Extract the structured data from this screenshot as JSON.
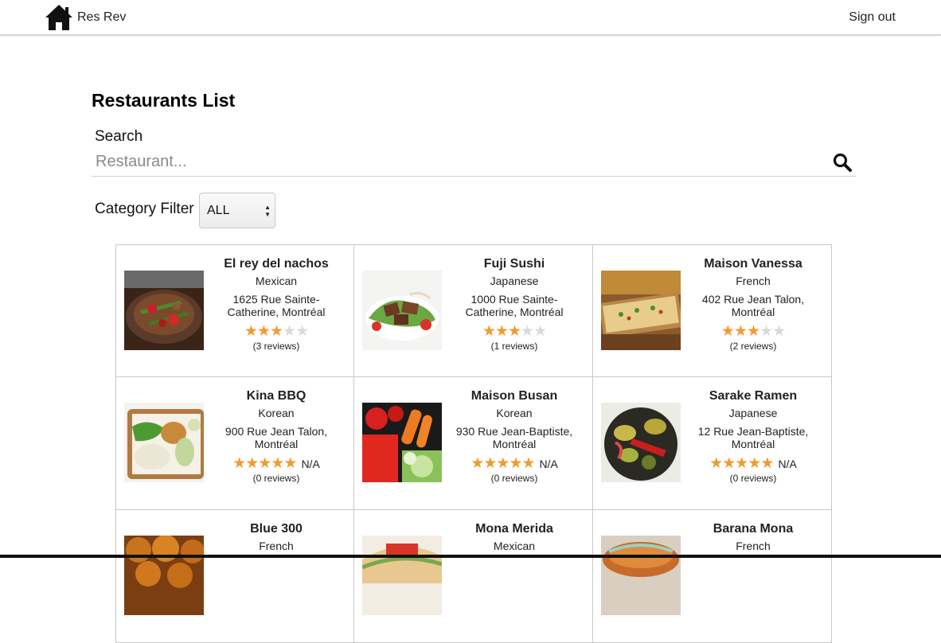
{
  "navbar": {
    "brand": "Res Rev",
    "signout_label": "Sign out",
    "brand_icon": "home-icon"
  },
  "page": {
    "title": "Restaurants List"
  },
  "search": {
    "label": "Search",
    "placeholder": "Restaurant...",
    "value": "",
    "button_icon": "search-icon"
  },
  "filter": {
    "label": "Category Filter",
    "selected": "ALL"
  },
  "colors": {
    "star_filled": "#f29b2f",
    "star_empty": "#d9d9d9",
    "card_border": "#c8c8c8"
  },
  "restaurants": [
    {
      "name": "El rey del nachos",
      "category": "Mexican",
      "address": "1625 Rue Sainte-Catherine, Montréal",
      "rating": 3,
      "rating_text": "",
      "reviews": "(3 reviews)",
      "image": "mexican-dish"
    },
    {
      "name": "Fuji Sushi",
      "category": "Japanese",
      "address": "1000 Rue Sainte-Catherine, Montréal",
      "rating": 3,
      "rating_text": "",
      "reviews": "(1 reviews)",
      "image": "beef-salad"
    },
    {
      "name": "Maison Vanessa",
      "category": "French",
      "address": "402 Rue Jean Talon, Montréal",
      "rating": 3,
      "rating_text": "",
      "reviews": "(2 reviews)",
      "image": "flatbread"
    },
    {
      "name": "Kina BBQ",
      "category": "Korean",
      "address": "900 Rue Jean Talon, Montréal",
      "rating": 5,
      "rating_text": "N/A",
      "reviews": "(0 reviews)",
      "image": "bento-box"
    },
    {
      "name": "Maison Busan",
      "category": "Korean",
      "address": "930 Rue Jean-Baptiste, Montréal",
      "rating": 5,
      "rating_text": "N/A",
      "reviews": "(0 reviews)",
      "image": "vegetables"
    },
    {
      "name": "Sarake Ramen",
      "category": "Japanese",
      "address": "12 Rue Jean-Baptiste, Montréal",
      "rating": 5,
      "rating_text": "N/A",
      "reviews": "(0 reviews)",
      "image": "grilled-vegetables"
    },
    {
      "name": "Blue 300",
      "category": "French",
      "address": "",
      "rating": 0,
      "rating_text": "",
      "reviews": "",
      "image": "croquettes"
    },
    {
      "name": "Mona Merida",
      "category": "Mexican",
      "address": "",
      "rating": 0,
      "rating_text": "",
      "reviews": "",
      "image": "tacos"
    },
    {
      "name": "Barana Mona",
      "category": "French",
      "address": "",
      "rating": 0,
      "rating_text": "",
      "reviews": "",
      "image": "pastry"
    }
  ]
}
